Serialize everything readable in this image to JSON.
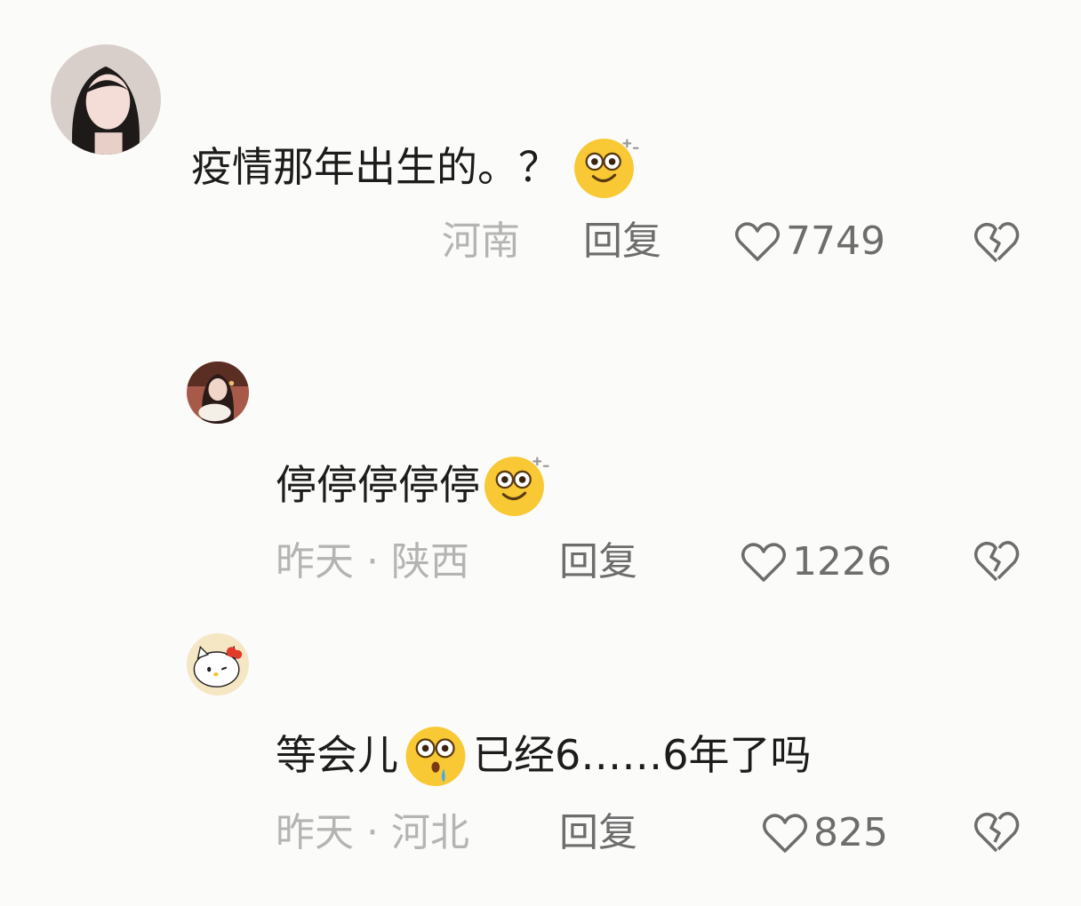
{
  "comments": [
    {
      "text_before": "疫情那年出生的。？",
      "text_after": "",
      "emoji": "dazed-face-icon",
      "location": "河南",
      "reply_label": "回复",
      "likes": "7749"
    },
    {
      "text_before": "停停停停停",
      "text_after": "",
      "emoji": "dazed-face-icon",
      "location": "昨天 · 陕西",
      "reply_label": "回复",
      "likes": "1226"
    },
    {
      "text_before": "等会儿",
      "text_after": "已经6……6年了吗",
      "emoji": "shocked-face-icon",
      "location": "昨天 · 河北",
      "reply_label": "回复",
      "likes": "825"
    }
  ],
  "colors": {
    "background": "#fbfbf9",
    "text": "#1c1c1c",
    "meta_text": "#b4b4b4",
    "action_text": "#6d6d6d",
    "emoji_yellow": "#f8c934"
  }
}
